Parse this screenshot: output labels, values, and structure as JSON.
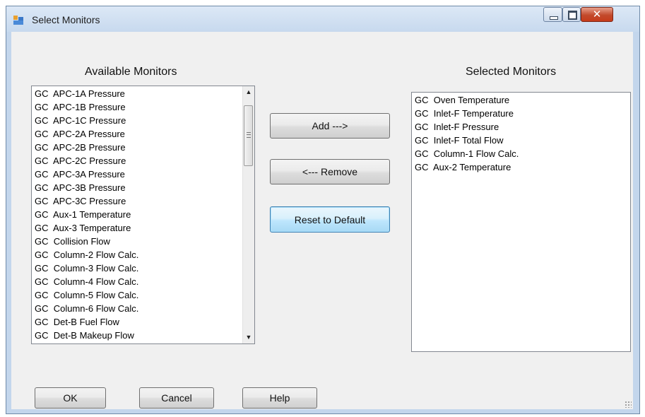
{
  "window": {
    "title": "Select Monitors"
  },
  "available": {
    "heading": "Available Monitors",
    "items": [
      "GC  APC-1A Pressure",
      "GC  APC-1B Pressure",
      "GC  APC-1C Pressure",
      "GC  APC-2A Pressure",
      "GC  APC-2B Pressure",
      "GC  APC-2C Pressure",
      "GC  APC-3A Pressure",
      "GC  APC-3B Pressure",
      "GC  APC-3C Pressure",
      "GC  Aux-1 Temperature",
      "GC  Aux-3 Temperature",
      "GC  Collision Flow",
      "GC  Column-2 Flow Calc.",
      "GC  Column-3 Flow Calc.",
      "GC  Column-4 Flow Calc.",
      "GC  Column-5 Flow Calc.",
      "GC  Column-6 Flow Calc.",
      "GC  Det-B Fuel Flow",
      "GC  Det-B Makeup Flow"
    ]
  },
  "selected": {
    "heading": "Selected Monitors",
    "items": [
      "GC  Oven Temperature",
      "GC  Inlet-F Temperature",
      "GC  Inlet-F Pressure",
      "GC  Inlet-F Total Flow",
      "GC  Column-1 Flow Calc.",
      "GC  Aux-2 Temperature"
    ]
  },
  "buttons": {
    "add": "Add   --->",
    "remove": "<---  Remove",
    "reset": "Reset to Default",
    "ok": "OK",
    "cancel": "Cancel",
    "help": "Help"
  },
  "icons": {
    "app": "app-icon",
    "minimize": "minimize-icon",
    "maximize": "maximize-icon",
    "close": "close-icon",
    "scroll_up": "scroll-up-arrow-icon",
    "scroll_down": "scroll-down-arrow-icon"
  }
}
